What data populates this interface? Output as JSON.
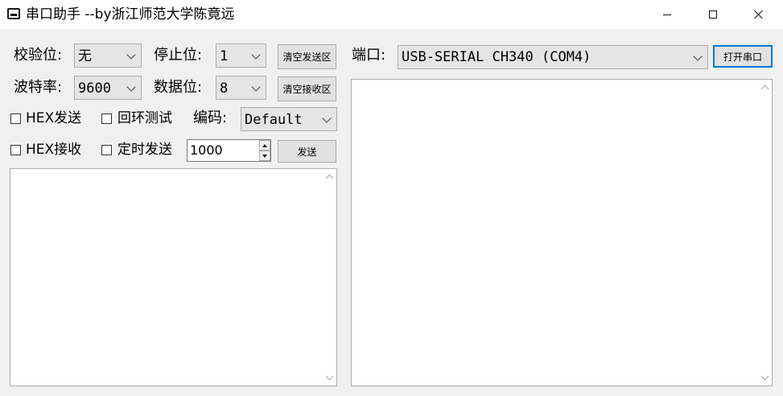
{
  "window": {
    "title": "串口助手  --by浙江师范大学陈竟远",
    "icons": {
      "app": "serial-port-icon",
      "minimize": "minimize-icon",
      "maximize": "maximize-icon",
      "close": "close-icon"
    }
  },
  "settings": {
    "parity": {
      "label": "校验位:",
      "value": "无"
    },
    "stop_bits": {
      "label": "停止位:",
      "value": "1"
    },
    "baud_rate": {
      "label": "波特率:",
      "value": "9600"
    },
    "data_bits": {
      "label": "数据位:",
      "value": "8"
    },
    "encoding": {
      "label": "编码:",
      "value": "Default"
    }
  },
  "buttons": {
    "clear_send": "清空发送区",
    "clear_receive": "清空接收区",
    "send": "发送",
    "open_port": "打开串口"
  },
  "checkboxes": {
    "hex_send": "HEX发送",
    "loopback_test": "回环测试",
    "hex_receive": "HEX接收",
    "timed_send": "定时发送"
  },
  "timer": {
    "interval": "1000"
  },
  "port": {
    "label": "端口:",
    "value": "USB-SERIAL CH340 (COM4)"
  },
  "send_area": {
    "content": ""
  },
  "receive_area": {
    "content": ""
  }
}
